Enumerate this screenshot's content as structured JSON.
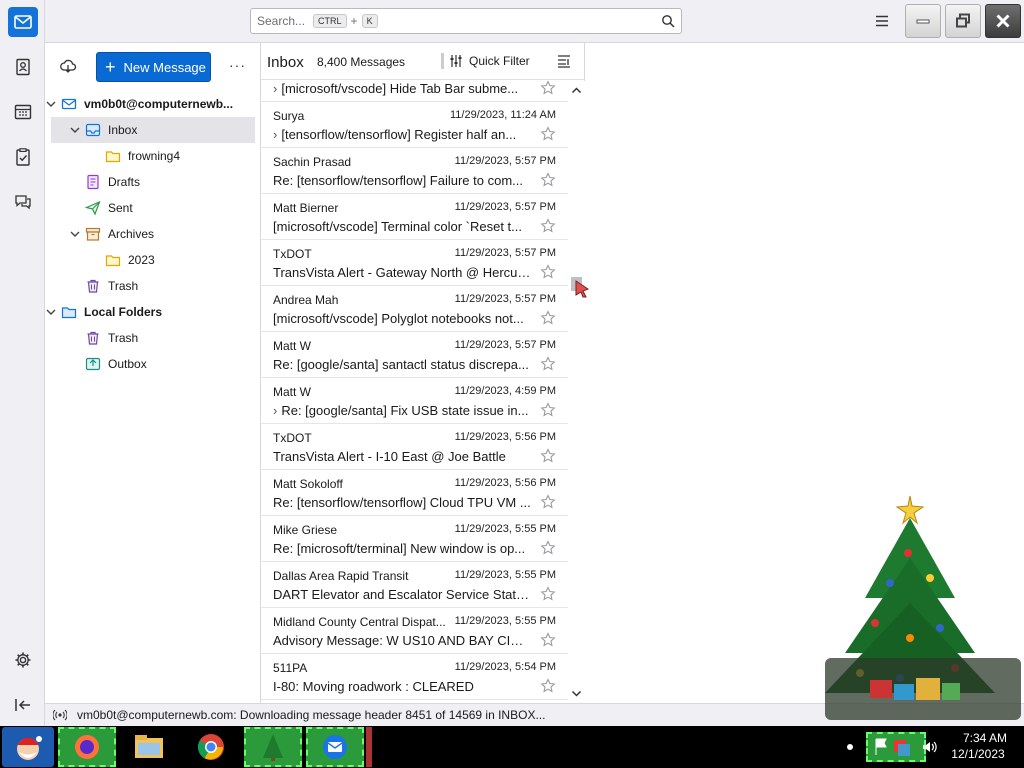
{
  "search": {
    "placeholder": "Search...",
    "shortcut_mod": "CTRL",
    "shortcut_plus": "+",
    "shortcut_key": "K"
  },
  "folder_pane": {
    "new_message_label": "New Message",
    "more_label": "···",
    "folders": [
      {
        "label": "vm0b0t@computernewb...",
        "icon": "account-icon",
        "level": 0,
        "bold": true,
        "twisty": "expanded"
      },
      {
        "label": "Inbox",
        "icon": "inbox-icon",
        "level": 1,
        "selected": true,
        "twisty": "expanded"
      },
      {
        "label": "frowning4",
        "icon": "folder-icon",
        "level": 2
      },
      {
        "label": "Drafts",
        "icon": "drafts-icon",
        "level": 1
      },
      {
        "label": "Sent",
        "icon": "sent-icon",
        "level": 1
      },
      {
        "label": "Archives",
        "icon": "archive-icon",
        "level": 1,
        "twisty": "expanded"
      },
      {
        "label": "2023",
        "icon": "folder-icon",
        "level": 2
      },
      {
        "label": "Trash",
        "icon": "trash-icon",
        "level": 1
      },
      {
        "label": "Local Folders",
        "icon": "local-folders-icon",
        "level": 0,
        "bold": true,
        "twisty": "expanded"
      },
      {
        "label": "Trash",
        "icon": "trash-icon",
        "level": 1
      },
      {
        "label": "Outbox",
        "icon": "outbox-icon",
        "level": 1
      }
    ]
  },
  "message_list": {
    "title": "Inbox",
    "count": "8,400 Messages",
    "quick_filter_label": "Quick Filter",
    "messages": [
      {
        "from": "",
        "date": "",
        "subject": "[microsoft/vscode] Hide Tab Bar subme...",
        "thread": true
      },
      {
        "from": "Surya",
        "date": "11/29/2023, 11:24 AM",
        "subject": "[tensorflow/tensorflow] Register half an...",
        "thread": true
      },
      {
        "from": "Sachin Prasad",
        "date": "11/29/2023, 5:57 PM",
        "subject": "Re: [tensorflow/tensorflow] Failure to com...",
        "thread": false
      },
      {
        "from": "Matt Bierner",
        "date": "11/29/2023, 5:57 PM",
        "subject": "[microsoft/vscode] Terminal color `Reset t...",
        "thread": false
      },
      {
        "from": "TxDOT",
        "date": "11/29/2023, 5:57 PM",
        "subject": "TransVista Alert - Gateway North @ Hercul...",
        "thread": false
      },
      {
        "from": "Andrea Mah",
        "date": "11/29/2023, 5:57 PM",
        "subject": "[microsoft/vscode] Polyglot notebooks not...",
        "thread": false
      },
      {
        "from": "Matt W",
        "date": "11/29/2023, 5:57 PM",
        "subject": "Re: [google/santa] santactl status discrepa...",
        "thread": false
      },
      {
        "from": "Matt W",
        "date": "11/29/2023, 4:59 PM",
        "subject": "Re: [google/santa] Fix USB state issue in...",
        "thread": true
      },
      {
        "from": "TxDOT",
        "date": "11/29/2023, 5:56 PM",
        "subject": "TransVista Alert - I-10 East @ Joe Battle",
        "thread": false
      },
      {
        "from": "Matt Sokoloff",
        "date": "11/29/2023, 5:56 PM",
        "subject": "Re: [tensorflow/tensorflow] Cloud TPU VM ...",
        "thread": false
      },
      {
        "from": "Mike Griese",
        "date": "11/29/2023, 5:55 PM",
        "subject": "Re: [microsoft/terminal] New window is op...",
        "thread": false
      },
      {
        "from": "Dallas Area Rapid Transit",
        "date": "11/29/2023, 5:55 PM",
        "subject": "DART Elevator and Escalator Service Statu...",
        "thread": false
      },
      {
        "from": "Midland County Central Dispat...",
        "date": "11/29/2023, 5:55 PM",
        "subject": "Advisory Message: W US10 AND BAY CITY ...",
        "thread": false
      },
      {
        "from": "511PA",
        "date": "11/29/2023, 5:54 PM",
        "subject": "I-80: Moving roadwork : CLEARED",
        "thread": false
      }
    ]
  },
  "status_bar": {
    "text": "vm0b0t@computernewb.com: Downloading message header 8451 of 14569 in INBOX..."
  },
  "taskbar": {
    "time": "7:34 AM",
    "date": "12/1/2023"
  },
  "colors": {
    "accent": "#0a6ad3",
    "selection": "#e4e4e8",
    "chrome": "#f0f0f4"
  }
}
